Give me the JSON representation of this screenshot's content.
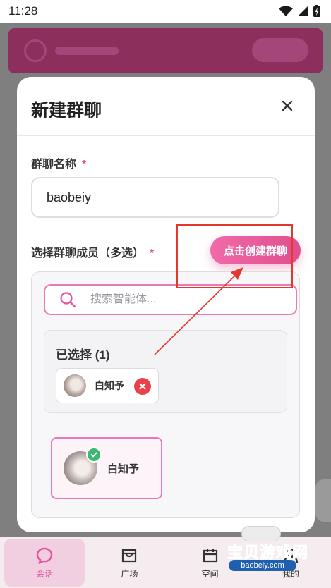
{
  "status_bar": {
    "time": "11:28"
  },
  "modal": {
    "title": "新建群聊",
    "name_label": "群聊名称",
    "required_mark": "*",
    "name_value": "baobeiy",
    "members_label": "选择群聊成员（多选）",
    "create_button": "点击创建群聊",
    "search_placeholder": "搜索智能体...",
    "selected_title": "已选择 (1)",
    "selected_chips": [
      {
        "name": "白知予"
      }
    ],
    "members": [
      {
        "name": "白知予",
        "checked": true
      }
    ]
  },
  "bottom_nav": {
    "items": [
      {
        "label": "会话",
        "icon": "chat-bubble-icon",
        "active": true
      },
      {
        "label": "广场",
        "icon": "storefront-icon",
        "active": false
      },
      {
        "label": "空间",
        "icon": "calendar-icon",
        "active": false
      },
      {
        "label": "我的",
        "icon": "user-icon",
        "active": false
      }
    ]
  },
  "watermark": {
    "text": "宝贝游戏网",
    "domain": "baobeiy.com"
  },
  "colors": {
    "accent": "#e0559b",
    "danger": "#e8414a",
    "success": "#3cb872",
    "annotation": "#e2392c"
  }
}
